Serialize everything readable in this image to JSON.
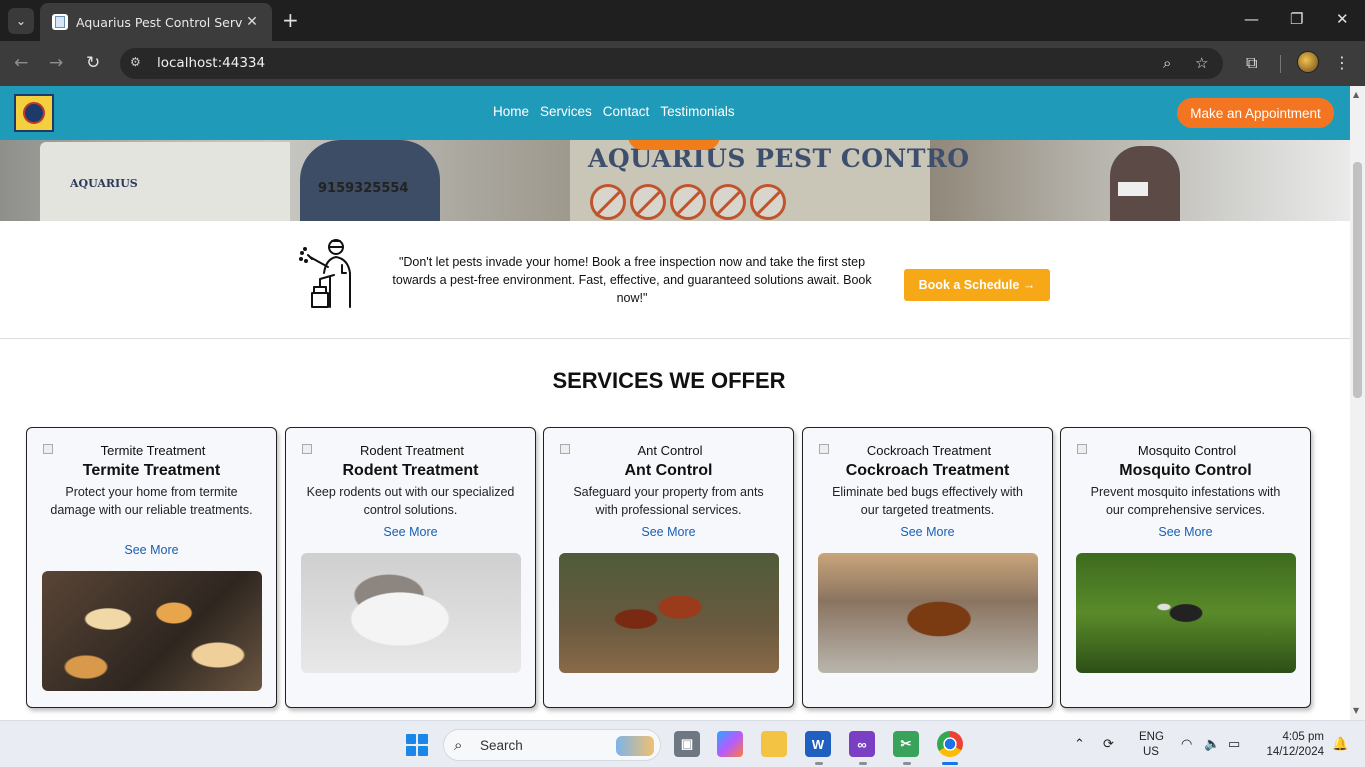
{
  "browser": {
    "tab_title": "Aquarius Pest Control Services",
    "url": "localhost:44334"
  },
  "navbar": {
    "links": [
      "Home",
      "Services",
      "Contact",
      "Testimonials"
    ],
    "appointment_label": "Make an Appointment"
  },
  "hero": {
    "banner_text": "AQUARIUS PEST CONTRO",
    "van_text": "AQUARIUS",
    "phone_text": "9159325554"
  },
  "cta": {
    "text": "\"Don't let pests invade your home! Book a free inspection now and take the first step towards a pest-free environment. Fast, effective, and guaranteed solutions await. Book now!\"",
    "button_label": "Book a Schedule →"
  },
  "services": {
    "title": "SERVICES WE OFFER",
    "cards": [
      {
        "alt": "Termite Treatment",
        "title": "Termite Treatment",
        "description": "Protect your home from termite damage with our reliable treatments.",
        "link": "See More"
      },
      {
        "alt": "Rodent Treatment",
        "title": "Rodent Treatment",
        "description": "Keep rodents out with our specialized control solutions.",
        "link": "See More"
      },
      {
        "alt": "Ant Control",
        "title": "Ant Control",
        "description": "Safeguard your property from ants with professional services.",
        "link": "See More"
      },
      {
        "alt": "Cockroach Treatment",
        "title": "Cockroach Treatment",
        "description": "Eliminate bed bugs effectively with our targeted treatments.",
        "link": "See More"
      },
      {
        "alt": "Mosquito Control",
        "title": "Mosquito Control",
        "description": "Prevent mosquito infestations with our comprehensive services.",
        "link": "See More"
      }
    ]
  },
  "taskbar": {
    "search_label": "Search",
    "lang_line1": "ENG",
    "lang_line2": "US",
    "time": "4:05 pm",
    "date": "14/12/2024",
    "apps": [
      "file-explorer-app",
      "copilot-app",
      "folder-app",
      "word-app",
      "visual-studio-app",
      "snipping-app",
      "chrome-app"
    ]
  },
  "colors": {
    "nav_bg": "#209ab9",
    "appointment_btn": "#f47521",
    "book_btn": "#f7a816",
    "link_blue": "#1a5fb4"
  }
}
